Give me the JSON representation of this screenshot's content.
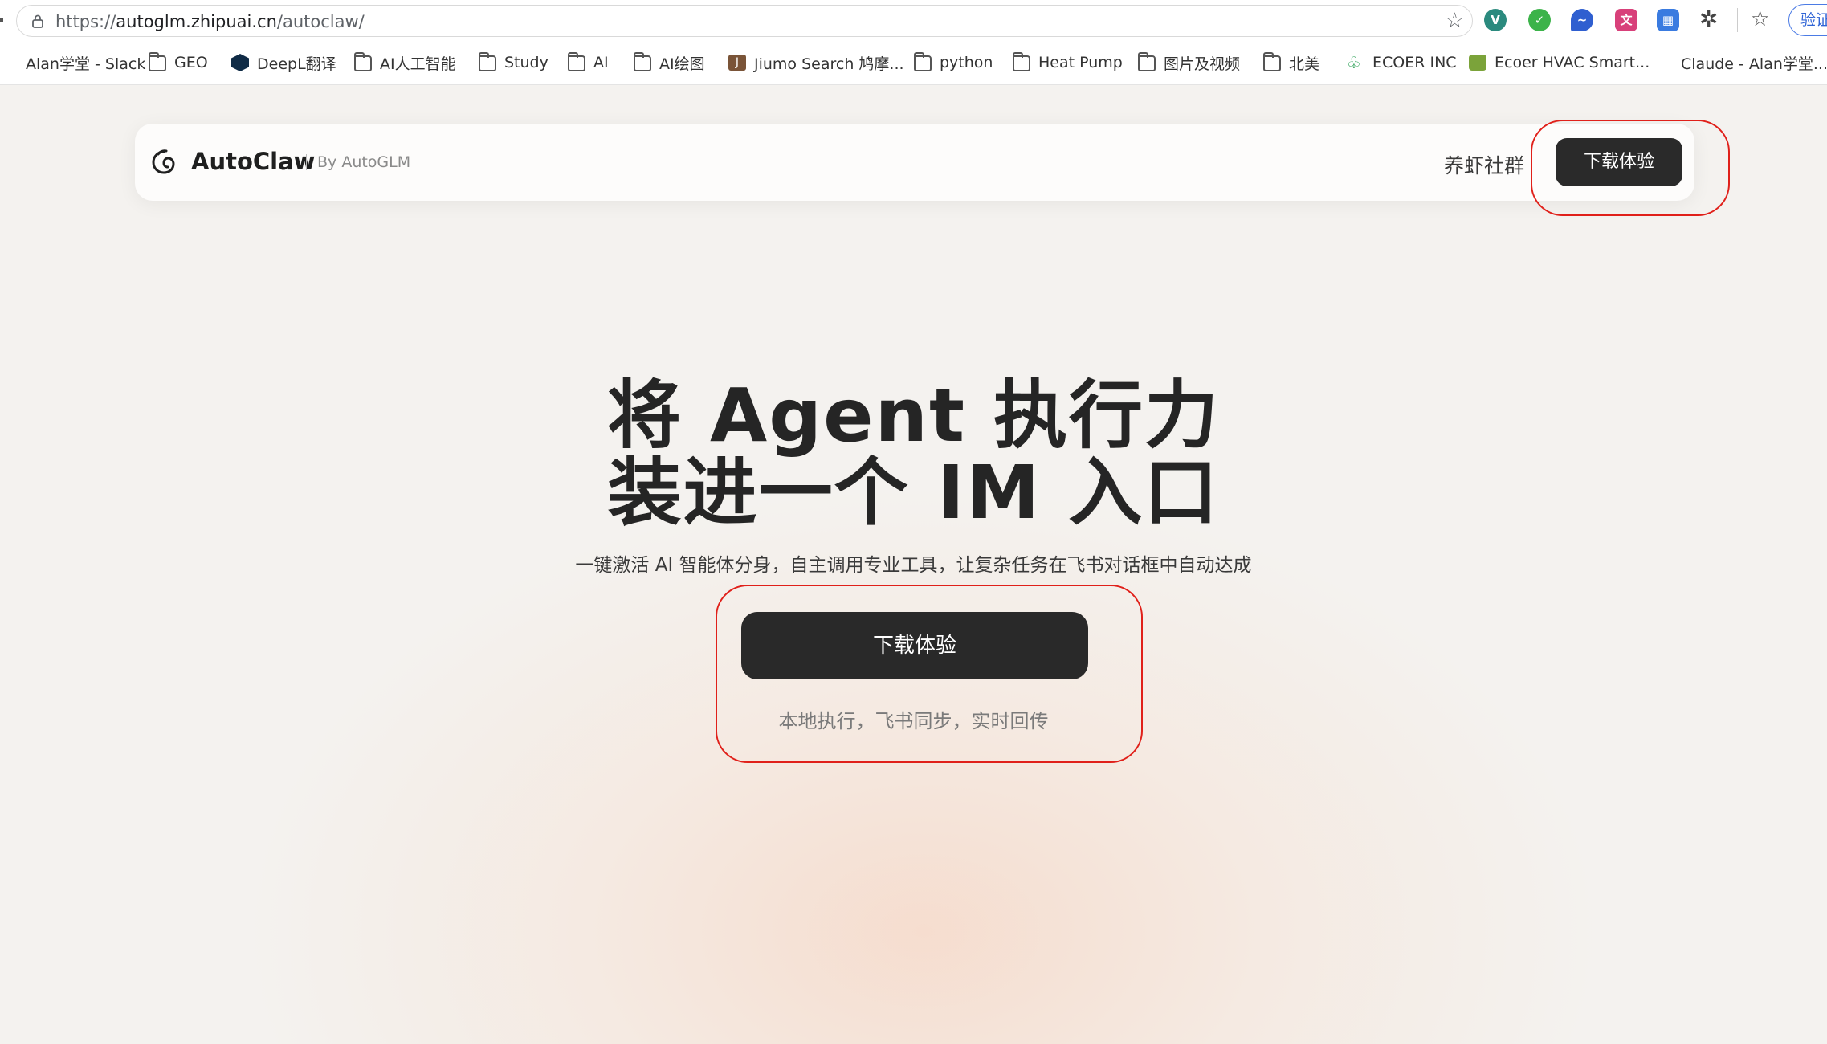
{
  "browser": {
    "url_prefix": "https://",
    "url_domain": "autoglm.zhipuai.cn",
    "url_path": "/autoclaw/",
    "verify_label": "验证",
    "bookmarks": [
      {
        "label": "Alan学堂 - Slack",
        "icon": "slack-icon"
      },
      {
        "label": "GEO",
        "icon": "folder-icon"
      },
      {
        "label": "DeepL翻译",
        "icon": "deepl-icon"
      },
      {
        "label": "AI人工智能",
        "icon": "folder-icon"
      },
      {
        "label": "Study",
        "icon": "folder-icon"
      },
      {
        "label": "AI",
        "icon": "folder-icon"
      },
      {
        "label": "AI绘图",
        "icon": "folder-icon"
      },
      {
        "label": "Jiumo Search 鸠摩...",
        "icon": "jiumo-icon"
      },
      {
        "label": "python",
        "icon": "folder-icon"
      },
      {
        "label": "Heat Pump",
        "icon": "folder-icon"
      },
      {
        "label": "图片及视频",
        "icon": "folder-icon"
      },
      {
        "label": "北美",
        "icon": "folder-icon"
      },
      {
        "label": "ECOER INC",
        "icon": "ecoer-icon"
      },
      {
        "label": "Ecoer HVAC Smart...",
        "icon": "leaf-icon"
      },
      {
        "label": "Claude - Alan学堂...",
        "icon": "slack-icon"
      }
    ]
  },
  "nav": {
    "brand": "AutoClaw",
    "byline": "By AutoGLM",
    "community": "养虾社群",
    "download": "下载体验"
  },
  "hero": {
    "title_line1": "将 Agent 执行力",
    "title_line2": "装进一个 IM 入口",
    "subtitle": "一键激活 AI 智能体分身，自主调用专业工具，让复杂任务在飞书对话框中自动达成",
    "download": "下载体验",
    "tagline": "本地执行，飞书同步，实时回传"
  },
  "colors": {
    "annotation": "#e0201a",
    "button": "#292929",
    "background": "#f4f2ef"
  }
}
